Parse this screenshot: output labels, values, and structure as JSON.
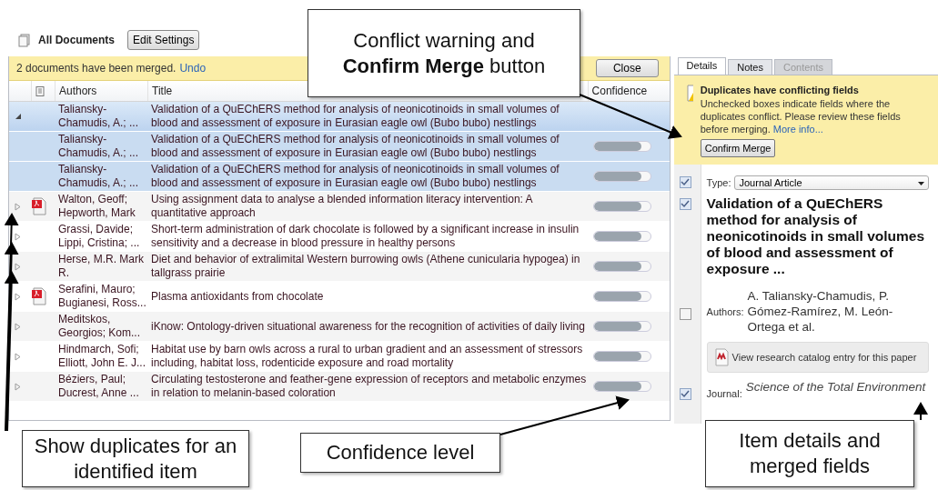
{
  "toolbar": {
    "title": "All Documents",
    "button": "Edit Settings"
  },
  "merge_bar": {
    "message": "2 documents have been merged.",
    "link": "Undo",
    "button": "Close"
  },
  "table": {
    "columns": [
      "Authors",
      "Title",
      "Confidence"
    ],
    "rows": [
      {
        "expanded": true,
        "has_pdf": false,
        "selected": true,
        "authors": "Taliansky-Chamudis, A.; ...",
        "title": "Validation of a QuEChERS method for analysis of neonicotinoids in small volumes of blood and assessment of exposure in Eurasian eagle owl (Bubo bubo) nestlings",
        "children": [
          {
            "has_pdf": false,
            "selected": true,
            "authors": "Taliansky-Chamudis, A.; ...",
            "title": "Validation of a QuEChERS method for analysis of neonicotinoids in small volumes of blood and assessment of exposure in Eurasian eagle owl (Bubo bubo) nestlings",
            "level": 0.85
          },
          {
            "has_pdf": false,
            "selected": true,
            "authors": "Taliansky-Chamudis, A.; ...",
            "title": "Validation of a QuEChERS method for analysis of neonicotinoids in small volumes of blood and assessment of exposure in Eurasian eagle owl (Bubo bubo) nestlings",
            "level": 0.85
          }
        ]
      },
      {
        "expanded": false,
        "has_pdf": true,
        "selected": false,
        "authors": "Walton, Geoff; Hepworth, Mark",
        "title": "Using assignment data to analyse a blended information literacy intervention: A quantitative approach",
        "level": 0.85
      },
      {
        "expanded": false,
        "has_pdf": false,
        "selected": false,
        "authors": "Grassi, Davide; Lippi, Cristina; ...",
        "title": "Short-term administration of dark chocolate is followed by a significant increase in insulin sensitivity and a decrease in blood pressure in healthy persons",
        "level": 0.85
      },
      {
        "expanded": false,
        "has_pdf": false,
        "selected": false,
        "authors": "Herse, M.R. Mark R.",
        "title": "Diet and behavior of extralimital Western burrowing owls (Athene cunicularia hypogea) in tallgrass prairie",
        "level": 0.85
      },
      {
        "expanded": false,
        "has_pdf": true,
        "selected": false,
        "authors": "Serafini, Mauro; Bugianesi, Ross...",
        "title": "Plasma antioxidants from chocolate",
        "level": 0.85
      },
      {
        "expanded": false,
        "has_pdf": false,
        "selected": false,
        "authors": "Meditskos, Georgios; Kom...",
        "title": "iKnow: Ontology-driven situational awareness for the recognition of activities of daily living",
        "level": 0.85
      },
      {
        "expanded": false,
        "has_pdf": false,
        "selected": false,
        "authors": "Hindmarch, Sofi; Elliott, John E. J...",
        "title": "Habitat use by barn owls across a rural to urban gradient and an assessment of stressors including, habitat loss, rodenticide exposure and road mortality",
        "level": 0.85
      },
      {
        "expanded": false,
        "has_pdf": false,
        "selected": false,
        "authors": "Béziers, Paul; Ducrest, Anne ...",
        "title": "Circulating testosterone and feather-gene expression of receptors and metabolic enzymes in relation to melanin-based coloration",
        "level": 0.85
      }
    ]
  },
  "details": {
    "tabs": [
      {
        "label": "Details",
        "selected": true,
        "disabled": false
      },
      {
        "label": "Notes",
        "selected": false,
        "disabled": false
      },
      {
        "label": "Contents",
        "selected": false,
        "disabled": true
      }
    ],
    "notice": {
      "heading": "Duplicates have conflicting fields",
      "text": "Unchecked boxes indicate fields where the duplicates conflict. Please review these fields before merging.",
      "link": "More info...",
      "button": "Confirm Merge"
    },
    "type": {
      "label": "Type:",
      "value": "Journal Article",
      "checked": true
    },
    "title": {
      "text": "Validation of a QuEChERS method for analysis of neonicotinoids in small volumes of blood and assessment of exposure ...",
      "checked": true
    },
    "authors": {
      "label": "Authors:",
      "value": "A. Taliansky-Chamudis, P. Gómez-Ramírez, M. León-Ortega et al.",
      "checked": false
    },
    "catalog_button": "View research catalog entry for this paper",
    "journal": {
      "label": "Journal:",
      "value": "Science of the Total Environment",
      "checked": true
    }
  },
  "callouts": [
    {
      "text": "Conflict warning and **Confirm Merge** button"
    },
    {
      "text": "Show duplicates for an identified item"
    },
    {
      "text": "Confidence level"
    },
    {
      "text": "Item details and merged fields"
    }
  ]
}
